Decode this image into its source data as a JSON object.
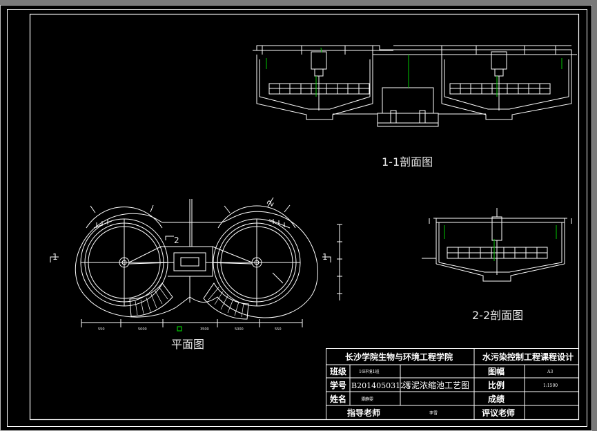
{
  "viewport": {
    "background": "#000000",
    "edge_color": "#6c6c6c"
  },
  "colors": {
    "line": "#ffffff",
    "accent": "#00c800",
    "frame": "#ffffff"
  },
  "labels": {
    "section_1_1": "1-1剖面图",
    "section_2_2": "2-2剖面图",
    "plan": "平面图",
    "cut_1_left": "1",
    "cut_1_right": "1",
    "cut_2_top": "2",
    "cut_2_side": "2"
  },
  "dimensions": [
    "550",
    "5000",
    "3500",
    "5000",
    "550"
  ],
  "title_block": {
    "school": "长沙学院生物与环境工程学院",
    "course": "水污染控制工程课程设计",
    "class_label": "班级",
    "class_value": "16环境1班",
    "drawing_no_label": "图幅",
    "drawing_no_value": "A3",
    "student_id_label": "学号",
    "student_id_value": "B20140503123",
    "drawing_title": "污泥浓缩池工艺图",
    "scale_label": "比例",
    "scale_value": "1:1500",
    "name_label": "姓名",
    "name_value": "谭静雯",
    "grade_label": "成绩",
    "grade_value": "",
    "advisor_label": "指导老师",
    "advisor_value": "李雪",
    "reviewer_label": "评议老师",
    "reviewer_value": ""
  }
}
